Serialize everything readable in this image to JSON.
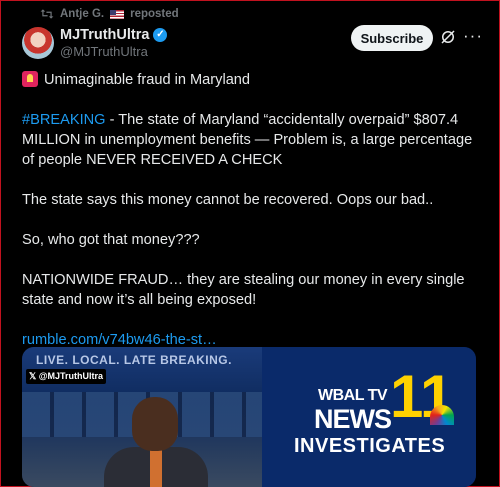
{
  "repost": {
    "text": "Antje G.",
    "suffix": "reposted",
    "icon": "repost-icon",
    "flag": "us-flag-icon"
  },
  "author": {
    "name": "MJTruthUltra",
    "handle": "@MJTruthUltra",
    "verified_icon": "verified-badge-icon",
    "avatar": "avatar-image"
  },
  "actions": {
    "subscribe_label": "Subscribe",
    "grok_icon": "grok-icon",
    "more_label": "···"
  },
  "post": {
    "headline": "Unimaginable fraud in Maryland",
    "headline_icon": "siren-emoji-icon",
    "hashtag": "#BREAKING",
    "para1_rest": " - The state of Maryland “accidentally overpaid” $807.4 MILLION in unemployment benefits — Problem is, a large percentage of people NEVER RECEIVED A CHECK",
    "para2": "The state says this money cannot be recovered. Oops our bad..",
    "para3": "So, who got that money???",
    "para4": "NATIONWIDE FRAUD… they are stealing our money in every single state and now it’s all being exposed!",
    "link": "rumble.com/v74bw46-the-st…"
  },
  "media": {
    "ticker": "LIVE. LOCAL. LATE BREAKING.",
    "watermark": "𝕏 @MJTruthUltra",
    "wbal": "WBAL TV",
    "news": "NEWS",
    "channel": "11",
    "investigates": "INVESTIGATES"
  },
  "colors": {
    "accent": "#1d9bf0",
    "background": "#000000",
    "text": "#e7e9ea",
    "muted": "#71767b",
    "frame": "#c1121f"
  }
}
